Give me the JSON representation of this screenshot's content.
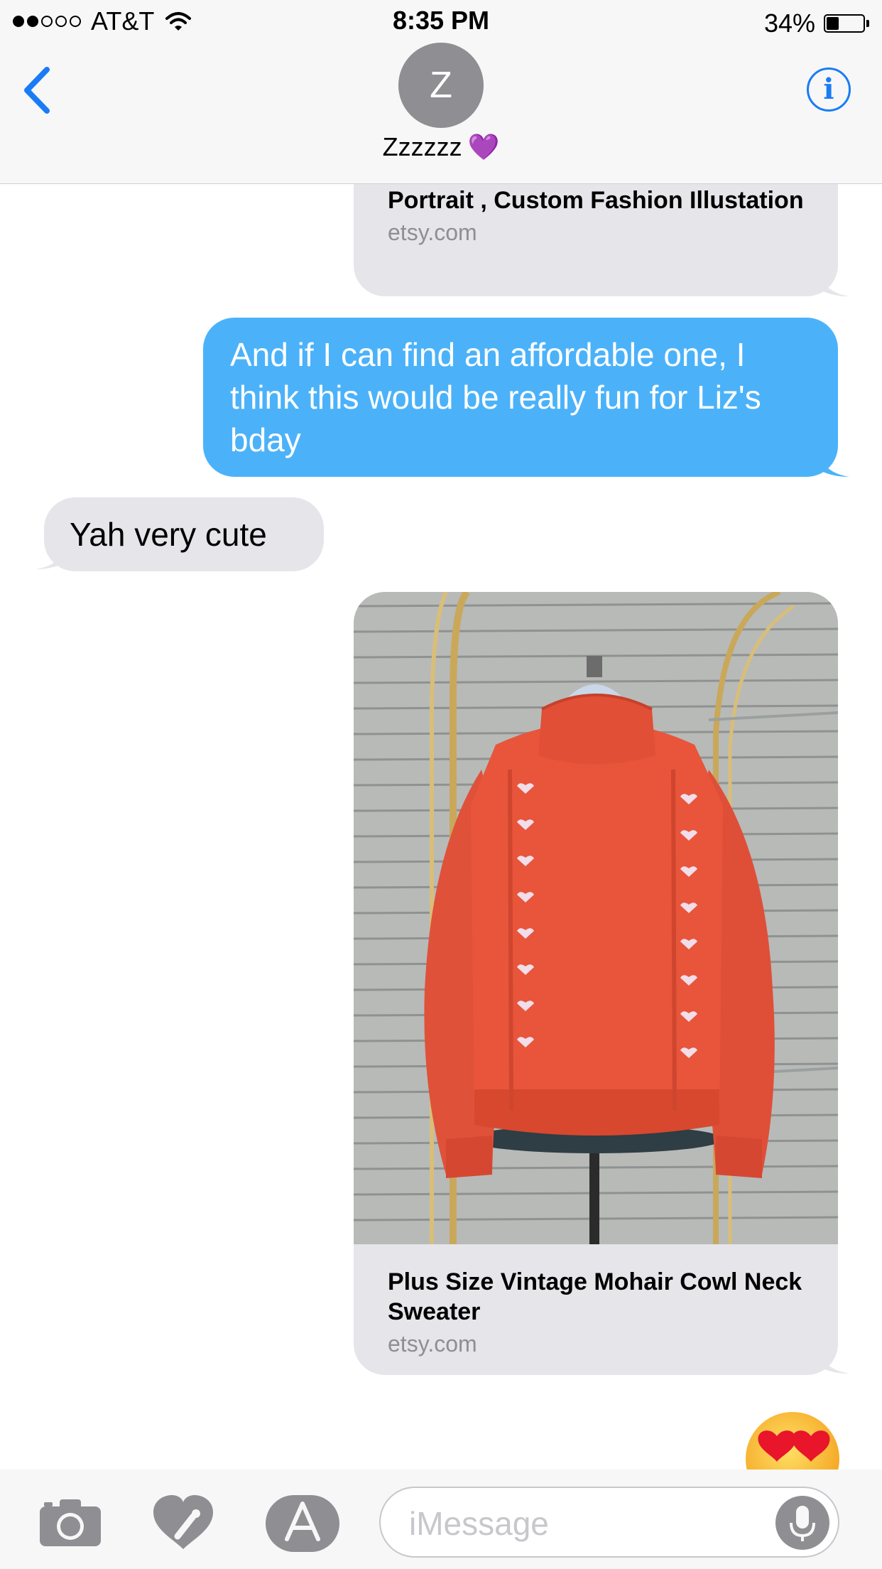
{
  "status_bar": {
    "carrier": "AT&T",
    "time": "8:35 PM",
    "battery": "34%",
    "battery_level": 0.34,
    "signal_bars_filled": 2,
    "signal_bars_total": 5
  },
  "header": {
    "avatar_initial": "Z",
    "contact_name": "Zzzzzz",
    "contact_emoji": "💜"
  },
  "messages": [
    {
      "type": "link-preview",
      "sender": "contact",
      "title": "Portrait , Custom Fashion Illustation",
      "domain": "etsy.com"
    },
    {
      "type": "text",
      "sender": "me",
      "text": "And if I can find an affordable one, I think this would be really fun for Liz's bday"
    },
    {
      "type": "text",
      "sender": "contact",
      "text": "Yah very cute"
    },
    {
      "type": "link-preview",
      "sender": "me",
      "title": "Plus Size Vintage Mohair Cowl Neck Sweater",
      "domain": "etsy.com",
      "image": "orange-mohair-sweater-photo"
    },
    {
      "type": "emoji",
      "sender": "me",
      "text": "😍"
    }
  ],
  "input_bar": {
    "placeholder": "iMessage",
    "icons": [
      "camera-icon",
      "digital-touch-icon",
      "app-store-icon",
      "microphone-icon"
    ]
  },
  "colors": {
    "accent": "#1a7cf5",
    "my_bubble": "#4bb2f9",
    "their_bubble": "#e5e5ea",
    "sweater": "#e8553a"
  }
}
